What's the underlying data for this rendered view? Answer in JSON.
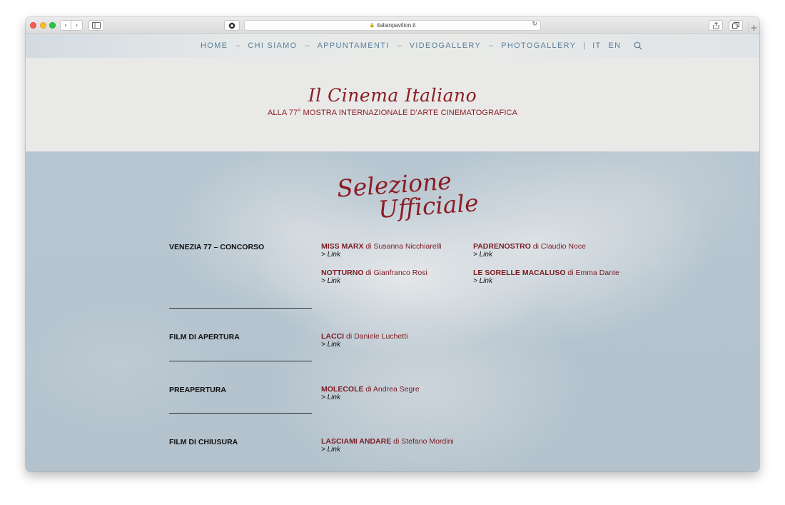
{
  "browser": {
    "url": "italianpavilion.it"
  },
  "nav": {
    "items": [
      {
        "label": "HOME"
      },
      {
        "label": "CHI SIAMO"
      },
      {
        "label": "APPUNTAMENTI"
      },
      {
        "label": "VIDEOGALLERY"
      },
      {
        "label": "PHOTOGALLERY"
      }
    ],
    "separator": "–",
    "pipe": "|",
    "languages": [
      "IT",
      "EN"
    ]
  },
  "hero": {
    "title": "Il Cinema Italiano",
    "subtitle_pre": "ALLA 77",
    "subtitle_sup": "A",
    "subtitle_post": " MOSTRA INTERNAZIONALE D'ARTE CINEMATOGRAFICA"
  },
  "section": {
    "title_line1": "Selezione",
    "title_line2": "Ufficiale"
  },
  "categories": [
    {
      "name": "VENEZIA 77 – CONCORSO",
      "films": [
        {
          "title": "MISS MARX",
          "by": " di Susanna Nicchiarelli",
          "link": "> Link"
        },
        {
          "title": "PADRENOSTRO",
          "by": " di Claudio Noce",
          "link": "> Link"
        },
        {
          "title": "NOTTURNO",
          "by": " di Gianfranco Rosi",
          "link": "> Link"
        },
        {
          "title": "LE SORELLE MACALUSO",
          "by": " di Emma Dante",
          "link": "> Link"
        }
      ]
    },
    {
      "name": "FILM DI APERTURA",
      "films": [
        {
          "title": "LACCI",
          "by": " di Daniele Luchetti",
          "link": "> Link"
        }
      ]
    },
    {
      "name": "PREAPERTURA",
      "films": [
        {
          "title": "MOLECOLE",
          "by": " di Andrea Segre",
          "link": "> Link"
        }
      ]
    },
    {
      "name": "FILM DI CHIUSURA",
      "films": [
        {
          "title": "LASCIAMI ANDARE",
          "by": " di Stefano Mordini",
          "link": "> Link"
        }
      ]
    }
  ],
  "colors": {
    "accent": "#8b1d24",
    "nav": "#5a7f9c"
  }
}
